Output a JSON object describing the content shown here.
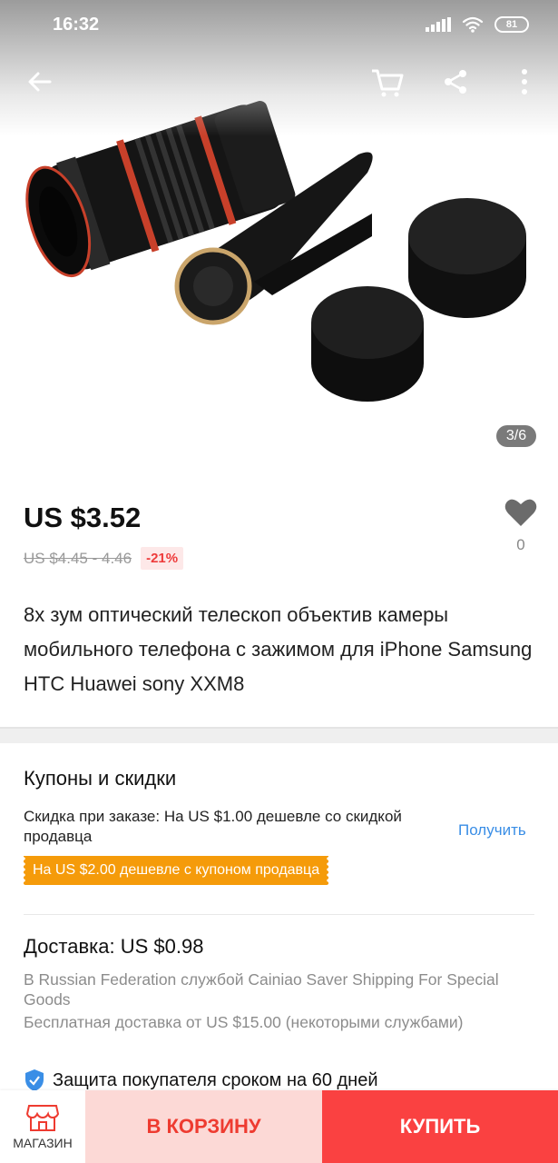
{
  "status_bar": {
    "time": "16:32",
    "battery": "81"
  },
  "gallery": {
    "page_indicator": "3/6"
  },
  "price": {
    "current": "US $3.52",
    "old": "US $4.45 - 4.46",
    "discount": "-21%"
  },
  "wishlist": {
    "count": "0"
  },
  "product": {
    "title": "8x зум оптический телескоп объектив камеры мобильного телефона с зажимом для iPhone Samsung HTC Huawei sony XXM8"
  },
  "coupons": {
    "title": "Купоны и скидки",
    "order_discount": "Скидка при заказе: На US $1.00 дешевле со скидкой продавца",
    "get_label": "Получить",
    "coupon_tag": "На US $2.00 дешевле с купоном продавца"
  },
  "shipping": {
    "title": "Доставка: US $0.98",
    "method": "В Russian Federation службой Cainiao Saver Shipping For Special Goods",
    "free": "Бесплатная доставка от US $15.00 (некоторыми службами)"
  },
  "protection": {
    "text": "Защита покупателя сроком на 60 дней"
  },
  "bottom_bar": {
    "store_label": "МАГАЗИН",
    "add_to_cart": "В КОРЗИНУ",
    "buy": "КУПИТЬ"
  },
  "colors": {
    "accent_red": "#fa4141",
    "cart_bg": "#fcd9d6",
    "coupon_orange": "#f59b0a",
    "link_blue": "#3a8ee6",
    "discount_red": "#ee3b3b"
  }
}
